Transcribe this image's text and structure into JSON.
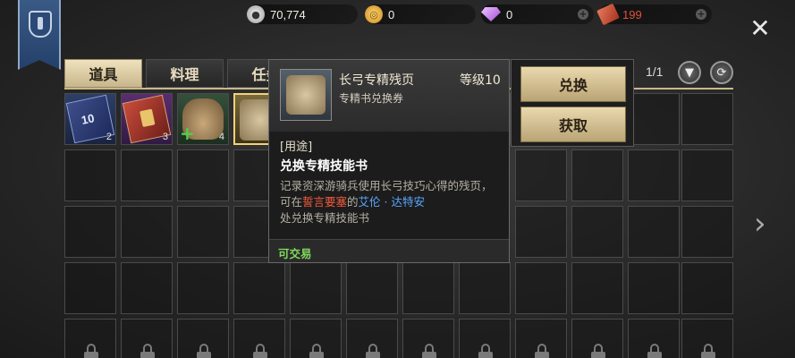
{
  "currencies": {
    "silver": {
      "value": "70,774"
    },
    "gold": {
      "value": "0"
    },
    "gem": {
      "value": "0"
    },
    "ticket": {
      "value": "199",
      "color": "#e0513c"
    }
  },
  "tabs": [
    {
      "label": "道具",
      "active": true
    },
    {
      "label": "料理",
      "active": false
    },
    {
      "label": "任务",
      "active": false
    }
  ],
  "page_counter": "1/1",
  "inventory": {
    "items": [
      {
        "count": "2",
        "icon": "silver-ticket-10-icon"
      },
      {
        "count": "3",
        "icon": "red-ticket-icon"
      },
      {
        "count": "4",
        "icon": "supply-bag-icon"
      },
      {
        "count": "",
        "icon": "skill-book-scroll-icon"
      }
    ],
    "hidden_counts": [
      "2",
      "2"
    ]
  },
  "tooltip": {
    "name": "长弓专精残页",
    "subtitle": "专精书兑换券",
    "level": "等级10",
    "usage_label": "[用途]",
    "usage": "兑换专精技能书",
    "desc_1": "记录资深游骑兵使用长弓技巧心得的残页，可在",
    "desc_place": "誓言要塞",
    "desc_2": "的",
    "desc_npc": "艾伦 · 达特安",
    "desc_3": "处兑换专精技能书",
    "tradable": "可交易"
  },
  "actions": {
    "exchange": "兑换",
    "obtain": "获取"
  }
}
